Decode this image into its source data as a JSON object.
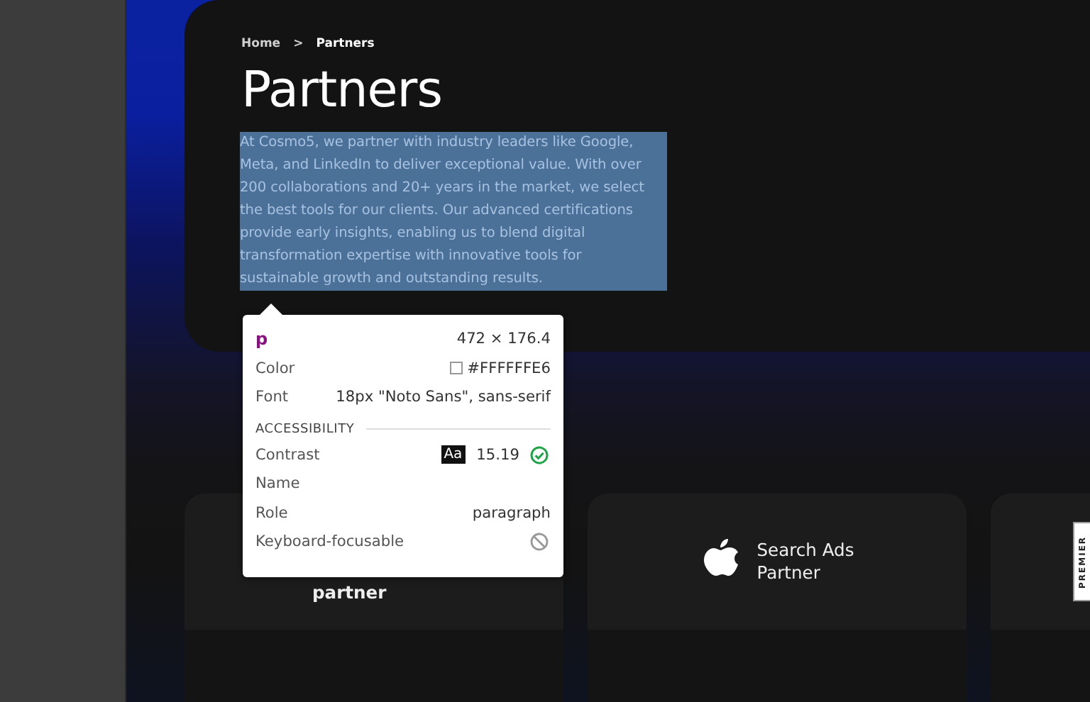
{
  "breadcrumb": {
    "items": [
      "Home",
      "Partners"
    ],
    "separator": ">"
  },
  "hero": {
    "title": "Partners",
    "text": "At Cosmo5, we partner with industry leaders like Google, Meta, and LinkedIn to deliver exceptional value. With over 200 collaborations and 20+ years in the market, we select the best tools for our clients. Our advanced certifications provide early insights, enabling us to blend digital transformation expertise with innovative tools for sustainable growth and outstanding results.",
    "highlighted": true
  },
  "inspector": {
    "tag": "p",
    "size": "472 × 176.4",
    "section": "ACCESSIBILITY",
    "rows": [
      {
        "label": "Color",
        "kind": "color",
        "value": "#FFFFFFE6"
      },
      {
        "label": "Font",
        "kind": "text",
        "value": "18px \"Noto Sans\", sans-serif"
      }
    ],
    "a11y": [
      {
        "label": "Contrast",
        "kind": "contrast",
        "badge": "Aa",
        "value": "15.19",
        "passed": true
      },
      {
        "label": "Name",
        "kind": "text"
      },
      {
        "label": "Role",
        "kind": "text",
        "value": "paragraph"
      },
      {
        "label": "Keyboard-focusable",
        "kind": "focusable",
        "focusable": false
      }
    ]
  },
  "cards": [
    {
      "kind": "text",
      "lines": [
        "partner"
      ]
    },
    {
      "kind": "apple",
      "lines": [
        "Search Ads",
        "Partner"
      ]
    },
    {
      "kind": "badge",
      "badge": "PREMIER"
    }
  ]
}
